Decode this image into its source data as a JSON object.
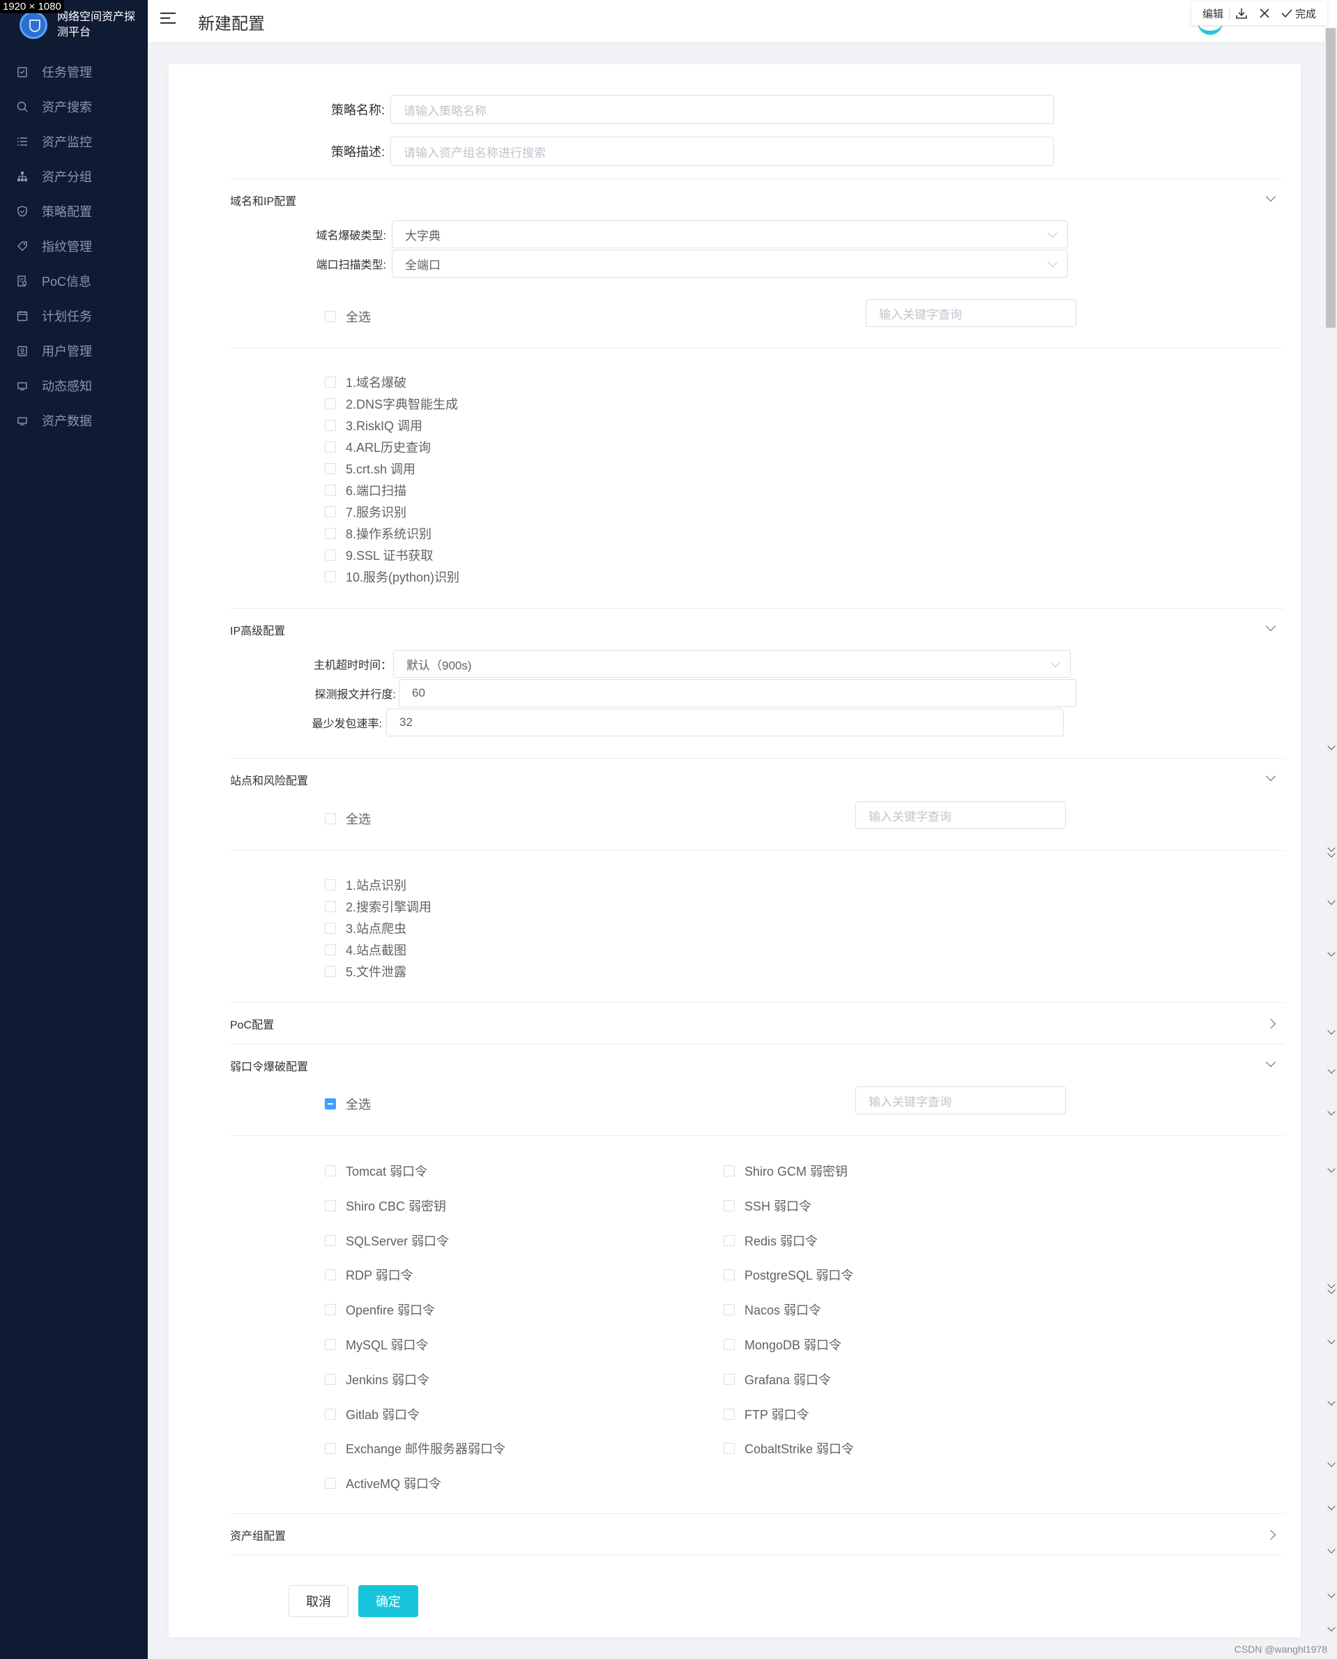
{
  "screenshot_label": "1920 × 1080",
  "sidebar": {
    "brand": "网络空间资产探测平台",
    "items": [
      {
        "label": "任务管理",
        "icon": "clipboard-icon"
      },
      {
        "label": "资产搜索",
        "icon": "search-icon"
      },
      {
        "label": "资产监控",
        "icon": "list-icon"
      },
      {
        "label": "资产分组",
        "icon": "hierarchy-icon"
      },
      {
        "label": "策略配置",
        "icon": "shield-icon"
      },
      {
        "label": "指纹管理",
        "icon": "tag-icon"
      },
      {
        "label": "PoC信息",
        "icon": "document-search-icon"
      },
      {
        "label": "计划任务",
        "icon": "calendar-icon"
      },
      {
        "label": "用户管理",
        "icon": "user-clipboard-icon"
      },
      {
        "label": "动态感知",
        "icon": "monitor-icon"
      },
      {
        "label": "资产数据",
        "icon": "monitor-icon"
      }
    ]
  },
  "header": {
    "title": "新建配置",
    "toolbar": {
      "edit": "编辑",
      "done": "完成"
    }
  },
  "form": {
    "name_label": "策略名称:",
    "name_placeholder": "请输入策略名称",
    "desc_label": "策略描述:",
    "desc_placeholder": "请输入资产组名称进行搜索"
  },
  "domain_ip": {
    "title": "域名和IP配置",
    "brute_label": "域名爆破类型:",
    "brute_value": "大字典",
    "port_label": "端口扫描类型:",
    "port_value": "全端口",
    "select_all": "全选",
    "search_placeholder": "输入关键字查询",
    "options": [
      "1.域名爆破",
      "2.DNS字典智能生成",
      "3.RiskIQ 调用",
      "4.ARL历史查询",
      "5.crt.sh 调用",
      "6.端口扫描",
      "7.服务识别",
      "8.操作系统识别",
      "9.SSL 证书获取",
      "10.服务(python)识别"
    ]
  },
  "ip_advanced": {
    "title": "IP高级配置",
    "timeout_label": "主机超时时间：",
    "timeout_value": "默认（900s)",
    "parallel_label": "探测报文并行度:",
    "parallel_value": "60",
    "rate_label": "最少发包速率:",
    "rate_value": "32"
  },
  "site_risk": {
    "title": "站点和风险配置",
    "select_all": "全选",
    "search_placeholder": "输入关键字查询",
    "options": [
      "1.站点识别",
      "2.搜索引擎调用",
      "3.站点爬虫",
      "4.站点截图",
      "5.文件泄露"
    ]
  },
  "poc": {
    "title": "PoC配置"
  },
  "weak_pass": {
    "title": "弱口令爆破配置",
    "select_all": "全选",
    "search_placeholder": "输入关键字查询",
    "left": [
      "Tomcat 弱口令",
      "Shiro CBC 弱密钥",
      "SQLServer 弱口令",
      "RDP 弱口令",
      "Openfire 弱口令",
      "MySQL 弱口令",
      "Jenkins 弱口令",
      "Gitlab 弱口令",
      "Exchange 邮件服务器弱口令",
      "ActiveMQ 弱口令"
    ],
    "right": [
      "Shiro GCM 弱密钥",
      "SSH 弱口令",
      "Redis 弱口令",
      "PostgreSQL 弱口令",
      "Nacos 弱口令",
      "MongoDB 弱口令",
      "Grafana 弱口令",
      "FTP 弱口令",
      "CobaltStrike 弱口令"
    ]
  },
  "asset_group": {
    "title": "资产组配置"
  },
  "actions": {
    "cancel": "取消",
    "ok": "确定"
  },
  "watermark": "CSDN @wanghl1978",
  "colors": {
    "sidebar_bg": "#0f1a33",
    "primary": "#18c4dc",
    "checkbox_active": "#409eff"
  }
}
